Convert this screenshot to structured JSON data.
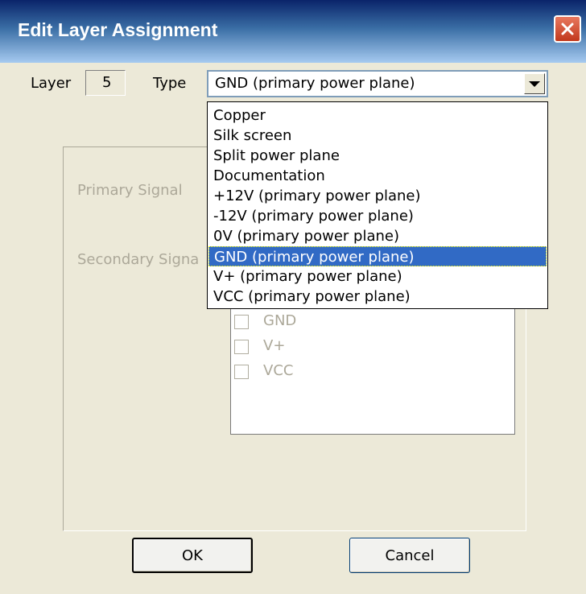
{
  "window": {
    "title": "Edit Layer Assignment"
  },
  "layer": {
    "label": "Layer",
    "value": "5"
  },
  "type": {
    "label": "Type",
    "selected": "GND  (primary power plane)",
    "options": [
      "Copper",
      "Silk screen",
      "Split power plane",
      "Documentation",
      "+12V  (primary power plane)",
      "-12V  (primary power plane)",
      "0V  (primary power plane)",
      "GND  (primary power plane)",
      "V+  (primary power plane)",
      "VCC  (primary power plane)"
    ],
    "selected_index": 7
  },
  "group": {
    "primary_signal_label": "Primary Signal",
    "secondary_signal_label": "Secondary Signa"
  },
  "secondary_list": {
    "items": [
      {
        "label": "GND",
        "checked": false
      },
      {
        "label": "V+",
        "checked": false
      },
      {
        "label": "VCC",
        "checked": false
      }
    ]
  },
  "buttons": {
    "ok": "OK",
    "cancel": "Cancel"
  },
  "colors": {
    "face": "#ece9d8",
    "highlight": "#316ac5",
    "disabled_text": "#aca899"
  }
}
